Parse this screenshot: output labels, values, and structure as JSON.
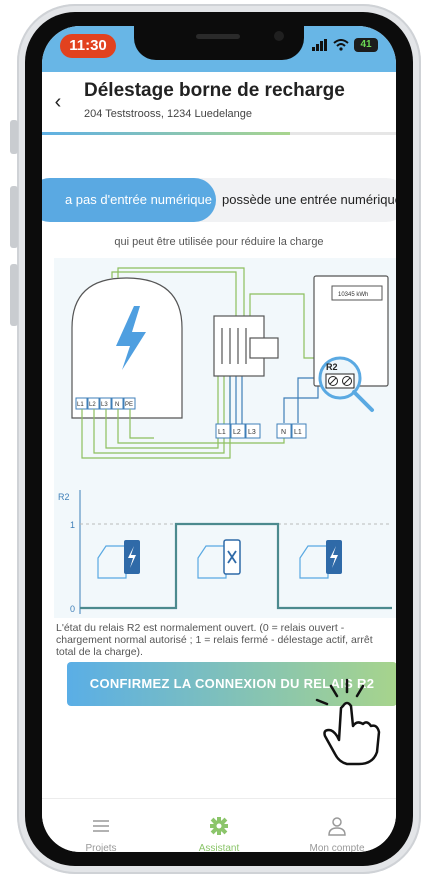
{
  "status_bar": {
    "time": "11:30",
    "battery": "41"
  },
  "header": {
    "title": "Délestage borne de recharge",
    "address": "204 Teststrooss, 1234 Luedelange"
  },
  "toggle": {
    "option_1": "a pas d'entrée numérique",
    "option_2": "possède une entrée numérique"
  },
  "caption": "qui peut être utilisée pour réduire la charge",
  "diagram": {
    "meter_reading": "10345 kWh",
    "relay_label": "R2",
    "charger_terminals": [
      "L1",
      "L2",
      "L3",
      "N",
      "PE"
    ],
    "breaker_terminals": [
      "L1",
      "L2",
      "L3"
    ],
    "neutral_terminals": [
      "N",
      "L1"
    ],
    "chart": {
      "y_label": "R2",
      "tick_high": "1",
      "tick_low": "0"
    }
  },
  "description": "L'état du relais R2 est normalement ouvert. (0 = relais ouvert - chargement normal autorisé ; 1 = relais fermé - délestage actif, arrêt total de la charge).",
  "confirm_button": "CONFIRMEZ LA CONNEXION DU RELAIS R2",
  "tabs": [
    {
      "label": "Projets",
      "icon": "menu-icon"
    },
    {
      "label": "Assistant",
      "icon": "gear-icon"
    },
    {
      "label": "Mon compte",
      "icon": "user-icon"
    }
  ],
  "colors": {
    "accent_blue": "#5aa9e2",
    "accent_green": "#a7d48c",
    "time_pill": "#e2421f",
    "diagram_green": "#8dbf5e",
    "diagram_blue": "#3f7fb8"
  }
}
